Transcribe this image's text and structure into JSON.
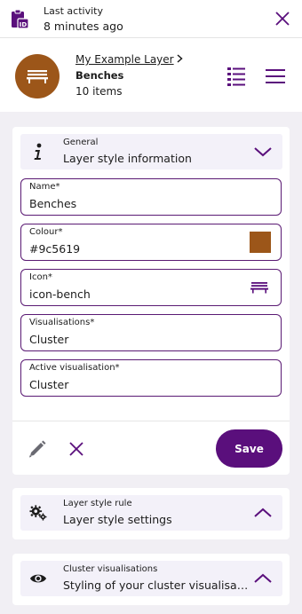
{
  "topbar": {
    "activity_label": "Last activity",
    "activity_value": "8 minutes ago"
  },
  "layer": {
    "breadcrumb": "My Example Layer",
    "name": "Benches",
    "count": "10 items",
    "avatar_color": "#9c5619"
  },
  "general_section": {
    "label": "General",
    "title": "Layer style information"
  },
  "fields": {
    "name": {
      "label": "Name*",
      "value": "Benches"
    },
    "colour": {
      "label": "Colour*",
      "value": "#9c5619"
    },
    "icon": {
      "label": "Icon*",
      "value": "icon-bench"
    },
    "visualisations": {
      "label": "Visualisations*",
      "value": "Cluster"
    },
    "active_visualisation": {
      "label": "Active visualisation*",
      "value": "Cluster"
    }
  },
  "actions": {
    "save_label": "Save"
  },
  "rule_section": {
    "label": "Layer style rule",
    "title": "Layer style settings"
  },
  "cluster_section": {
    "label": "Cluster visualisations",
    "title": "Styling of your cluster visualisatio..."
  },
  "colors": {
    "accent": "#5a0f7c",
    "field_border": "#5a1a73",
    "page_bg": "#f1eff4",
    "swatch": "#9c5619"
  },
  "icons": [
    "clipboard-id-icon",
    "close-icon",
    "bench-icon",
    "chevron-right-icon",
    "list-view-icon",
    "hamburger-menu-icon",
    "info-icon",
    "chevron-down-icon",
    "chevron-up-icon",
    "gears-icon",
    "eye-icon",
    "pencil-icon",
    "cancel-icon"
  ]
}
